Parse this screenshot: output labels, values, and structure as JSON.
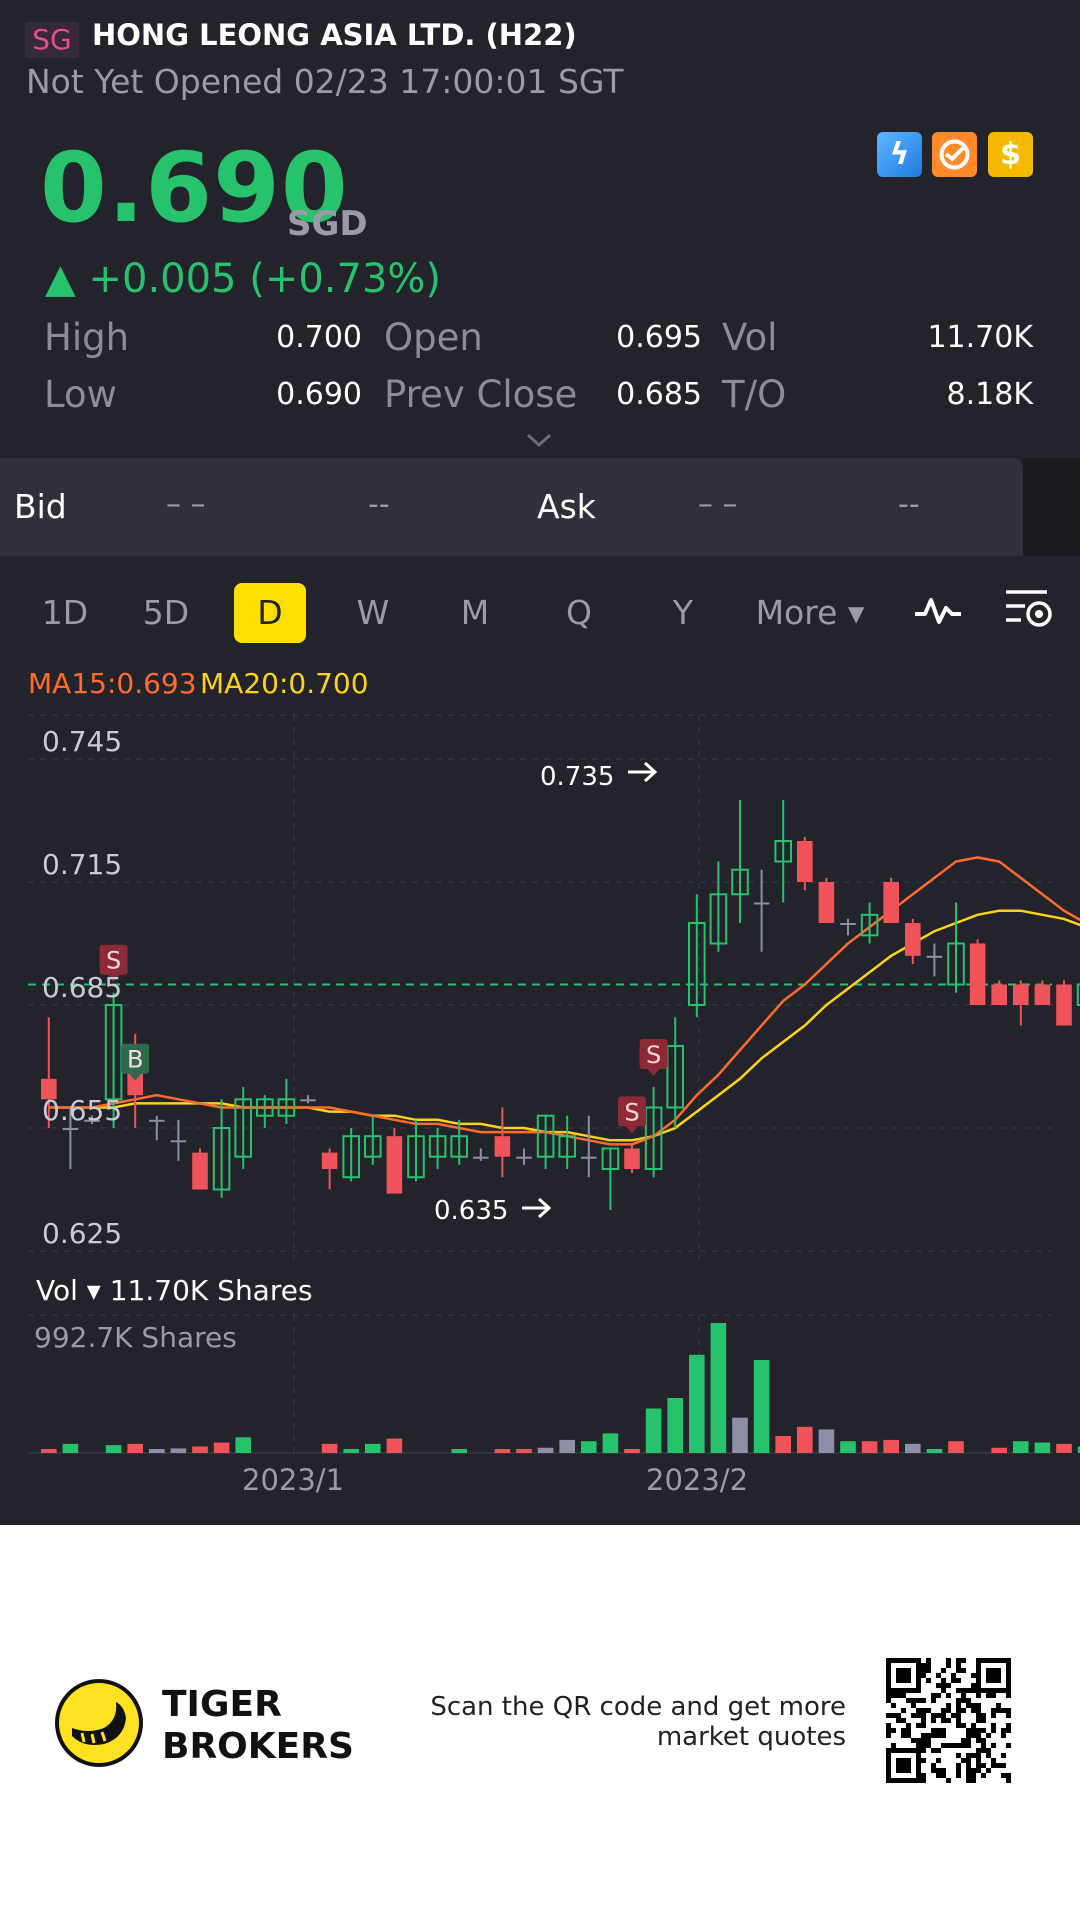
{
  "header": {
    "market": "SG",
    "title": "HONG LEONG ASIA LTD. (H22)",
    "status": "Not Yet Opened 02/23 17:00:01 SGT",
    "price": "0.690",
    "currency": "SGD",
    "change": "▲ +0.005 (+0.73%)",
    "badges": [
      "lightning-icon",
      "brokers-icon",
      "dollar-icon"
    ]
  },
  "stats": {
    "high_label": "High",
    "high": "0.700",
    "low_label": "Low",
    "low": "0.690",
    "open_label": "Open",
    "open": "0.695",
    "prev_label": "Prev Close",
    "prev": "0.685",
    "vol_label": "Vol",
    "vol": "11.70K",
    "to_label": "T/O",
    "to": "8.18K"
  },
  "bidask": {
    "bid_label": "Bid",
    "bid_price": "– –",
    "bid_size": "--",
    "ask_label": "Ask",
    "ask_price": "– –",
    "ask_size": "--"
  },
  "tabs": [
    {
      "label": "1D"
    },
    {
      "label": "5D"
    },
    {
      "label": "D"
    },
    {
      "label": "W"
    },
    {
      "label": "M"
    },
    {
      "label": "Q"
    },
    {
      "label": "Y"
    },
    {
      "label": "More ▾"
    }
  ],
  "indicators": {
    "ma15": "MA15:0.693",
    "ma20": "MA20:0.700"
  },
  "volume": {
    "label": "Vol ▾ 11.70K Shares",
    "max_label": "992.7K Shares"
  },
  "colors": {
    "up": "#27c26c",
    "down": "#f0545a",
    "flat": "#8e8fa6",
    "ma15": "#ff6b2c",
    "ma20": "#ffd21a",
    "accent": "#ffdf00"
  },
  "chart_data": {
    "type": "candlestick",
    "ylim": [
      0.625,
      0.755
    ],
    "y_ticks": [
      "0.745",
      "0.715",
      "0.685",
      "0.655",
      "0.625"
    ],
    "x_labels": [
      "2023/1",
      "2023/2"
    ],
    "max_annotation": "0.735",
    "min_annotation": "0.635",
    "last_price": 0.69,
    "signals": [
      {
        "label": "S",
        "index": 3
      },
      {
        "label": "B",
        "index": 4
      },
      {
        "label": "S",
        "index": 27
      },
      {
        "label": "S",
        "index": 28
      }
    ],
    "candles": [
      {
        "o": 0.667,
        "h": 0.682,
        "l": 0.655,
        "c": 0.662
      },
      {
        "o": 0.655,
        "h": 0.66,
        "l": 0.645,
        "c": 0.655
      },
      {
        "o": 0.657,
        "h": 0.658,
        "l": 0.656,
        "c": 0.657
      },
      {
        "o": 0.662,
        "h": 0.688,
        "l": 0.655,
        "c": 0.685
      },
      {
        "o": 0.675,
        "h": 0.678,
        "l": 0.655,
        "c": 0.663
      },
      {
        "o": 0.657,
        "h": 0.658,
        "l": 0.652,
        "c": 0.657
      },
      {
        "o": 0.652,
        "h": 0.657,
        "l": 0.647,
        "c": 0.652
      },
      {
        "o": 0.649,
        "h": 0.65,
        "l": 0.64,
        "c": 0.64
      },
      {
        "o": 0.64,
        "h": 0.662,
        "l": 0.638,
        "c": 0.655
      },
      {
        "o": 0.648,
        "h": 0.665,
        "l": 0.645,
        "c": 0.662
      },
      {
        "o": 0.658,
        "h": 0.663,
        "l": 0.655,
        "c": 0.662
      },
      {
        "o": 0.658,
        "h": 0.667,
        "l": 0.656,
        "c": 0.662
      },
      {
        "o": 0.662,
        "h": 0.663,
        "l": 0.661,
        "c": 0.662
      },
      {
        "o": 0.649,
        "h": 0.65,
        "l": 0.64,
        "c": 0.645
      },
      {
        "o": 0.643,
        "h": 0.655,
        "l": 0.642,
        "c": 0.653
      },
      {
        "o": 0.648,
        "h": 0.658,
        "l": 0.646,
        "c": 0.653
      },
      {
        "o": 0.653,
        "h": 0.655,
        "l": 0.64,
        "c": 0.639
      },
      {
        "o": 0.643,
        "h": 0.657,
        "l": 0.642,
        "c": 0.653
      },
      {
        "o": 0.648,
        "h": 0.655,
        "l": 0.645,
        "c": 0.653
      },
      {
        "o": 0.648,
        "h": 0.657,
        "l": 0.646,
        "c": 0.653
      },
      {
        "o": 0.648,
        "h": 0.65,
        "l": 0.647,
        "c": 0.648
      },
      {
        "o": 0.653,
        "h": 0.66,
        "l": 0.643,
        "c": 0.648
      },
      {
        "o": 0.648,
        "h": 0.65,
        "l": 0.646,
        "c": 0.648
      },
      {
        "o": 0.648,
        "h": 0.658,
        "l": 0.645,
        "c": 0.658
      },
      {
        "o": 0.648,
        "h": 0.658,
        "l": 0.645,
        "c": 0.653
      },
      {
        "o": 0.648,
        "h": 0.658,
        "l": 0.643,
        "c": 0.648
      },
      {
        "o": 0.645,
        "h": 0.65,
        "l": 0.635,
        "c": 0.65
      },
      {
        "o": 0.65,
        "h": 0.651,
        "l": 0.644,
        "c": 0.645
      },
      {
        "o": 0.645,
        "h": 0.665,
        "l": 0.643,
        "c": 0.66
      },
      {
        "o": 0.66,
        "h": 0.682,
        "l": 0.655,
        "c": 0.675
      },
      {
        "o": 0.685,
        "h": 0.712,
        "l": 0.682,
        "c": 0.705
      },
      {
        "o": 0.7,
        "h": 0.72,
        "l": 0.698,
        "c": 0.712
      },
      {
        "o": 0.712,
        "h": 0.735,
        "l": 0.705,
        "c": 0.718
      },
      {
        "o": 0.71,
        "h": 0.718,
        "l": 0.698,
        "c": 0.71
      },
      {
        "o": 0.72,
        "h": 0.735,
        "l": 0.71,
        "c": 0.725
      },
      {
        "o": 0.725,
        "h": 0.726,
        "l": 0.713,
        "c": 0.715
      },
      {
        "o": 0.715,
        "h": 0.716,
        "l": 0.705,
        "c": 0.705
      },
      {
        "o": 0.705,
        "h": 0.706,
        "l": 0.702,
        "c": 0.705
      },
      {
        "o": 0.702,
        "h": 0.71,
        "l": 0.7,
        "c": 0.707
      },
      {
        "o": 0.715,
        "h": 0.716,
        "l": 0.705,
        "c": 0.705
      },
      {
        "o": 0.705,
        "h": 0.706,
        "l": 0.695,
        "c": 0.697
      },
      {
        "o": 0.697,
        "h": 0.7,
        "l": 0.692,
        "c": 0.697
      },
      {
        "o": 0.69,
        "h": 0.71,
        "l": 0.688,
        "c": 0.7
      },
      {
        "o": 0.7,
        "h": 0.701,
        "l": 0.685,
        "c": 0.685
      },
      {
        "o": 0.69,
        "h": 0.691,
        "l": 0.685,
        "c": 0.685
      },
      {
        "o": 0.69,
        "h": 0.691,
        "l": 0.68,
        "c": 0.685
      },
      {
        "o": 0.69,
        "h": 0.691,
        "l": 0.685,
        "c": 0.685
      },
      {
        "o": 0.69,
        "h": 0.691,
        "l": 0.68,
        "c": 0.68
      },
      {
        "o": 0.685,
        "h": 0.697,
        "l": 0.682,
        "c": 0.69
      },
      {
        "o": 0.69,
        "h": 0.691,
        "l": 0.68,
        "c": 0.685
      },
      {
        "o": 0.692,
        "h": 0.693,
        "l": 0.688,
        "c": 0.69
      }
    ],
    "ma15": [
      0.66,
      0.66,
      0.66,
      0.661,
      0.662,
      0.663,
      0.662,
      0.661,
      0.66,
      0.66,
      0.66,
      0.66,
      0.66,
      0.66,
      0.659,
      0.658,
      0.657,
      0.656,
      0.656,
      0.655,
      0.654,
      0.654,
      0.654,
      0.654,
      0.653,
      0.652,
      0.651,
      0.651,
      0.653,
      0.657,
      0.663,
      0.668,
      0.674,
      0.68,
      0.686,
      0.69,
      0.695,
      0.7,
      0.704,
      0.708,
      0.712,
      0.716,
      0.72,
      0.721,
      0.72,
      0.716,
      0.712,
      0.708,
      0.705,
      0.701,
      0.699
    ],
    "ma20": [
      0.66,
      0.66,
      0.66,
      0.66,
      0.661,
      0.661,
      0.661,
      0.661,
      0.661,
      0.66,
      0.66,
      0.66,
      0.66,
      0.659,
      0.659,
      0.658,
      0.658,
      0.657,
      0.657,
      0.656,
      0.656,
      0.655,
      0.655,
      0.654,
      0.654,
      0.653,
      0.652,
      0.652,
      0.653,
      0.655,
      0.659,
      0.663,
      0.667,
      0.672,
      0.676,
      0.68,
      0.685,
      0.689,
      0.693,
      0.697,
      0.7,
      0.703,
      0.705,
      0.707,
      0.708,
      0.708,
      0.707,
      0.706,
      0.704,
      0.702,
      0.7
    ],
    "volumes": [
      {
        "v": 25,
        "d": "down"
      },
      {
        "v": 70,
        "d": "up"
      },
      {
        "v": 0,
        "d": "flat"
      },
      {
        "v": 60,
        "d": "up"
      },
      {
        "v": 70,
        "d": "down"
      },
      {
        "v": 30,
        "d": "flat"
      },
      {
        "v": 35,
        "d": "flat"
      },
      {
        "v": 50,
        "d": "down"
      },
      {
        "v": 80,
        "d": "down"
      },
      {
        "v": 120,
        "d": "up"
      },
      {
        "v": 0,
        "d": "flat"
      },
      {
        "v": 0,
        "d": "flat"
      },
      {
        "v": 0,
        "d": "flat"
      },
      {
        "v": 70,
        "d": "down"
      },
      {
        "v": 20,
        "d": "up"
      },
      {
        "v": 70,
        "d": "up"
      },
      {
        "v": 110,
        "d": "down"
      },
      {
        "v": 0,
        "d": "flat"
      },
      {
        "v": 0,
        "d": "flat"
      },
      {
        "v": 20,
        "d": "up"
      },
      {
        "v": 0,
        "d": "flat"
      },
      {
        "v": 30,
        "d": "down"
      },
      {
        "v": 20,
        "d": "down"
      },
      {
        "v": 40,
        "d": "flat"
      },
      {
        "v": 100,
        "d": "flat"
      },
      {
        "v": 90,
        "d": "up"
      },
      {
        "v": 150,
        "d": "up"
      },
      {
        "v": 30,
        "d": "down"
      },
      {
        "v": 340,
        "d": "up"
      },
      {
        "v": 420,
        "d": "up"
      },
      {
        "v": 750,
        "d": "up"
      },
      {
        "v": 992.7,
        "d": "up"
      },
      {
        "v": 270,
        "d": "flat"
      },
      {
        "v": 710,
        "d": "up"
      },
      {
        "v": 130,
        "d": "down"
      },
      {
        "v": 200,
        "d": "down"
      },
      {
        "v": 180,
        "d": "flat"
      },
      {
        "v": 90,
        "d": "up"
      },
      {
        "v": 90,
        "d": "down"
      },
      {
        "v": 100,
        "d": "down"
      },
      {
        "v": 70,
        "d": "flat"
      },
      {
        "v": 20,
        "d": "up"
      },
      {
        "v": 90,
        "d": "down"
      },
      {
        "v": 0,
        "d": "flat"
      },
      {
        "v": 40,
        "d": "down"
      },
      {
        "v": 90,
        "d": "up"
      },
      {
        "v": 80,
        "d": "up"
      },
      {
        "v": 70,
        "d": "down"
      },
      {
        "v": 50,
        "d": "up"
      },
      {
        "v": 40,
        "d": "down"
      },
      {
        "v": 20,
        "d": "down"
      }
    ]
  },
  "footer": {
    "brand_line1": "TIGER",
    "brand_line2": "BROKERS",
    "qr_line1": "Scan the QR code and get more",
    "qr_line2": "market quotes"
  }
}
